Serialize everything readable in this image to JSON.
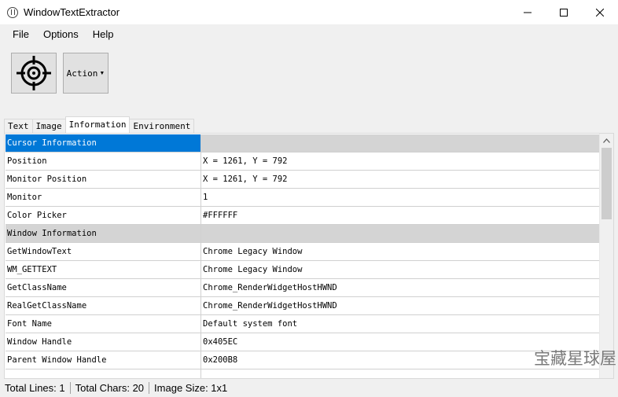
{
  "window": {
    "title": "WindowTextExtractor"
  },
  "menu": [
    "File",
    "Options",
    "Help"
  ],
  "toolbar": {
    "action_label": "Action"
  },
  "tabs": [
    {
      "label": "Text",
      "active": false
    },
    {
      "label": "Image",
      "active": false
    },
    {
      "label": "Information",
      "active": true
    },
    {
      "label": "Environment",
      "active": false
    }
  ],
  "info_rows": [
    {
      "key": "Cursor Information",
      "value": "",
      "header": true,
      "selected": true
    },
    {
      "key": "Position",
      "value": "X = 1261, Y = 792"
    },
    {
      "key": "Monitor Position",
      "value": "X = 1261, Y = 792"
    },
    {
      "key": "Monitor",
      "value": "1"
    },
    {
      "key": "Color Picker",
      "value": "#FFFFFF"
    },
    {
      "key": "Window Information",
      "value": "",
      "header": true
    },
    {
      "key": "GetWindowText",
      "value": "Chrome Legacy Window"
    },
    {
      "key": "WM_GETTEXT",
      "value": "Chrome Legacy Window"
    },
    {
      "key": "GetClassName",
      "value": "Chrome_RenderWidgetHostHWND"
    },
    {
      "key": "RealGetClassName",
      "value": "Chrome_RenderWidgetHostHWND"
    },
    {
      "key": "Font Name",
      "value": "Default system font"
    },
    {
      "key": "Window Handle",
      "value": "0x405EC"
    },
    {
      "key": "Parent Window Handle",
      "value": "0x200B8"
    },
    {
      "key": "",
      "value": ""
    }
  ],
  "status": {
    "total_lines": "Total Lines: 1",
    "total_chars": "Total Chars: 20",
    "image_size": "Image Size: 1x1"
  },
  "watermark": "宝藏星球屋",
  "colors": {
    "selection": "#0078d7",
    "header_row": "#d4d4d4"
  }
}
